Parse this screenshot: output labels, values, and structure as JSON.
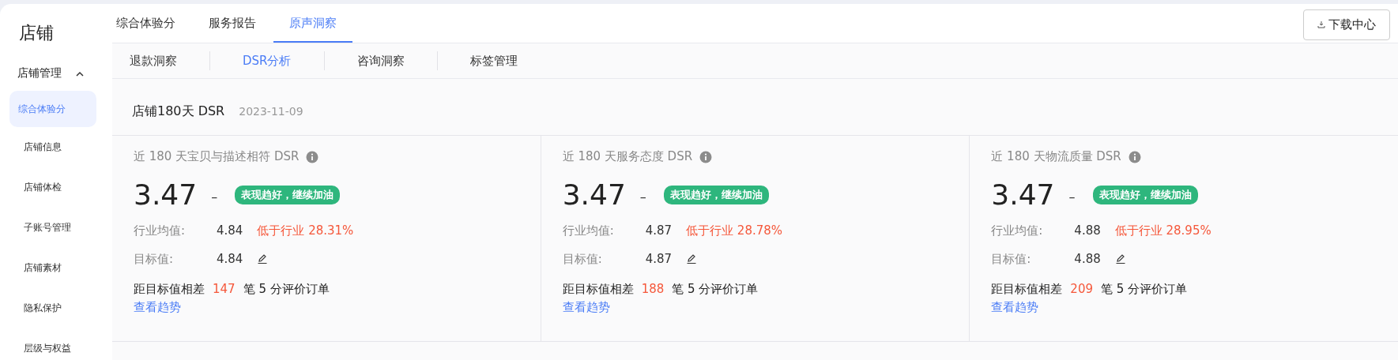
{
  "sidebar": {
    "title": "店铺",
    "section": {
      "label": "店铺管理",
      "expanded": true
    },
    "items": [
      {
        "label": "综合体验分",
        "selected": true
      },
      {
        "label": "店铺信息",
        "selected": false
      },
      {
        "label": "店铺体检",
        "selected": false
      },
      {
        "label": "子账号管理",
        "selected": false
      },
      {
        "label": "店铺素材",
        "selected": false
      },
      {
        "label": "隐私保护",
        "selected": false
      },
      {
        "label": "层级与权益",
        "selected": false
      }
    ]
  },
  "tabs": [
    {
      "label": "综合体验分",
      "selected": false
    },
    {
      "label": "服务报告",
      "selected": false
    },
    {
      "label": "原声洞察",
      "selected": true
    }
  ],
  "download_button": "下载中心",
  "subtabs": [
    {
      "label": "退款洞察",
      "selected": false
    },
    {
      "label": "DSR分析",
      "selected": true
    },
    {
      "label": "咨询洞察",
      "selected": false
    },
    {
      "label": "标签管理",
      "selected": false
    }
  ],
  "section": {
    "title": "店铺180天 DSR",
    "date": "2023-11-09"
  },
  "cards": [
    {
      "title": "近 180 天宝贝与描述相符 DSR",
      "value": "3.47",
      "trend": "–",
      "badge": "表现趋好，继续加油",
      "industry_label": "行业均值:",
      "industry_value": "4.84",
      "comparison": "低于行业 28.31%",
      "target_label": "目标值:",
      "target_value": "4.84",
      "gap_prefix": "距目标值相差",
      "gap_count": "147",
      "gap_suffix": "笔 5 分评价订单",
      "link": "查看趋势"
    },
    {
      "title": "近 180 天服务态度 DSR",
      "value": "3.47",
      "trend": "–",
      "badge": "表现趋好，继续加油",
      "industry_label": "行业均值:",
      "industry_value": "4.87",
      "comparison": "低于行业 28.78%",
      "target_label": "目标值:",
      "target_value": "4.87",
      "gap_prefix": "距目标值相差",
      "gap_count": "188",
      "gap_suffix": "笔 5 分评价订单",
      "link": "查看趋势"
    },
    {
      "title": "近 180 天物流质量 DSR",
      "value": "3.47",
      "trend": "–",
      "badge": "表现趋好，继续加油",
      "industry_label": "行业均值:",
      "industry_value": "4.88",
      "comparison": "低于行业 28.95%",
      "target_label": "目标值:",
      "target_value": "4.88",
      "gap_prefix": "距目标值相差",
      "gap_count": "209",
      "gap_suffix": "笔 5 分评价订单",
      "link": "查看趋势"
    }
  ]
}
